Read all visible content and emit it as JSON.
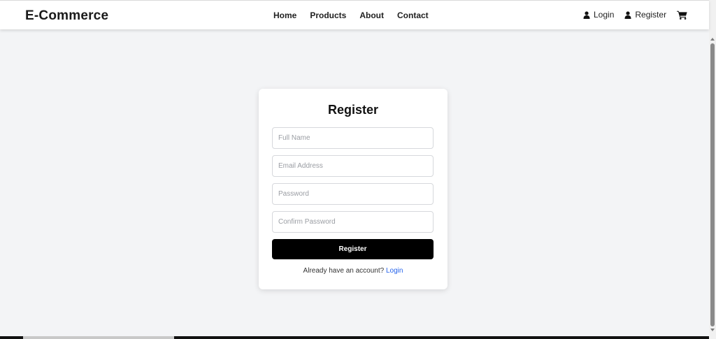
{
  "header": {
    "brand": "E-Commerce",
    "nav": [
      "Home",
      "Products",
      "About",
      "Contact"
    ],
    "login_label": "Login",
    "register_label": "Register"
  },
  "form": {
    "title": "Register",
    "fields": [
      {
        "placeholder": "Full Name",
        "value": ""
      },
      {
        "placeholder": "Email Address",
        "value": ""
      },
      {
        "placeholder": "Password",
        "value": ""
      },
      {
        "placeholder": "Confirm Password",
        "value": ""
      }
    ],
    "submit_label": "Register",
    "footer_text": "Already have an account?",
    "footer_link": "Login"
  },
  "icons": {
    "login": "user-icon",
    "register": "user-icon",
    "cart": "cart-icon"
  },
  "colors": {
    "background": "#f3f4f6",
    "button": "#000000",
    "link": "#2563eb"
  }
}
